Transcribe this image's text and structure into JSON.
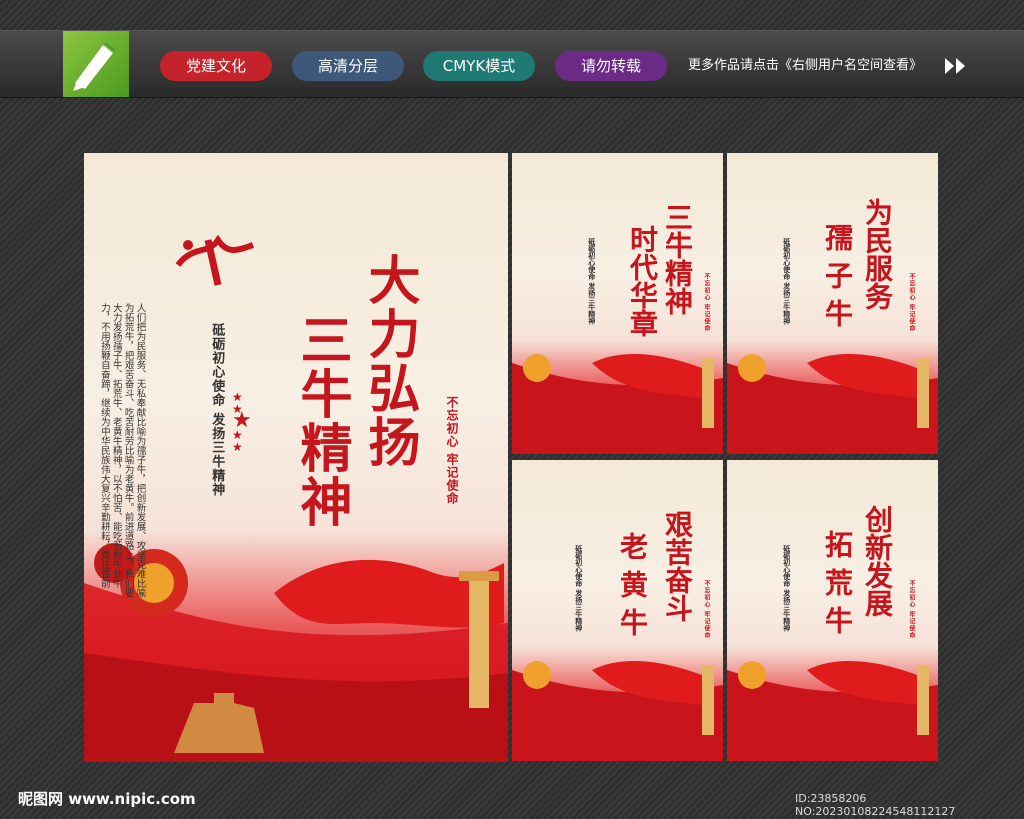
{
  "header": {
    "tags": [
      {
        "label": "党建文化",
        "color": "#c4232b"
      },
      {
        "label": "高清分层",
        "color": "#3d5878"
      },
      {
        "label": "CMYK模式",
        "color": "#1f7a74"
      },
      {
        "label": "请勿转载",
        "color": "#6b2a86"
      }
    ],
    "notice": "更多作品请点击《右侧用户名空间查看》"
  },
  "main_poster": {
    "title": "大力弘扬",
    "title2": "三牛精神",
    "subtitle": "砥砺初心使命 发扬三牛精神",
    "stamp": "不忘初心 牢记使命",
    "body": "人们把为民服务、无私奉献比喻为孺子牛，把创新发展、攻坚克难比喻为拓荒牛，把艰苦奋斗、吃苦耐劳比喻为老黄牛。前进道路上，我们要大力发扬孺子牛、拓荒牛、老黄牛精神，以不怕苦、能吃苦的牛劲牛力，不用扬鞭自奋蹄，继续为中华民族伟大复兴辛勤耕耘，勇往直前"
  },
  "small_posters": [
    {
      "title1": "三牛精神",
      "title2": "时代华章"
    },
    {
      "title1": "为民服务",
      "title2": "孺子牛"
    },
    {
      "title1": "艰苦奋斗",
      "title2": "老黄牛"
    },
    {
      "title1": "创新发展",
      "title2": "拓荒牛"
    }
  ],
  "small_common": {
    "subtitle": "砥砺初心使命 发扬三牛精神",
    "stamp": "不忘初心 牢记使命"
  },
  "watermark": {
    "left": "昵图网 www.nipic.com",
    "right": "ID:23858206 NO:20230108224548112127"
  }
}
